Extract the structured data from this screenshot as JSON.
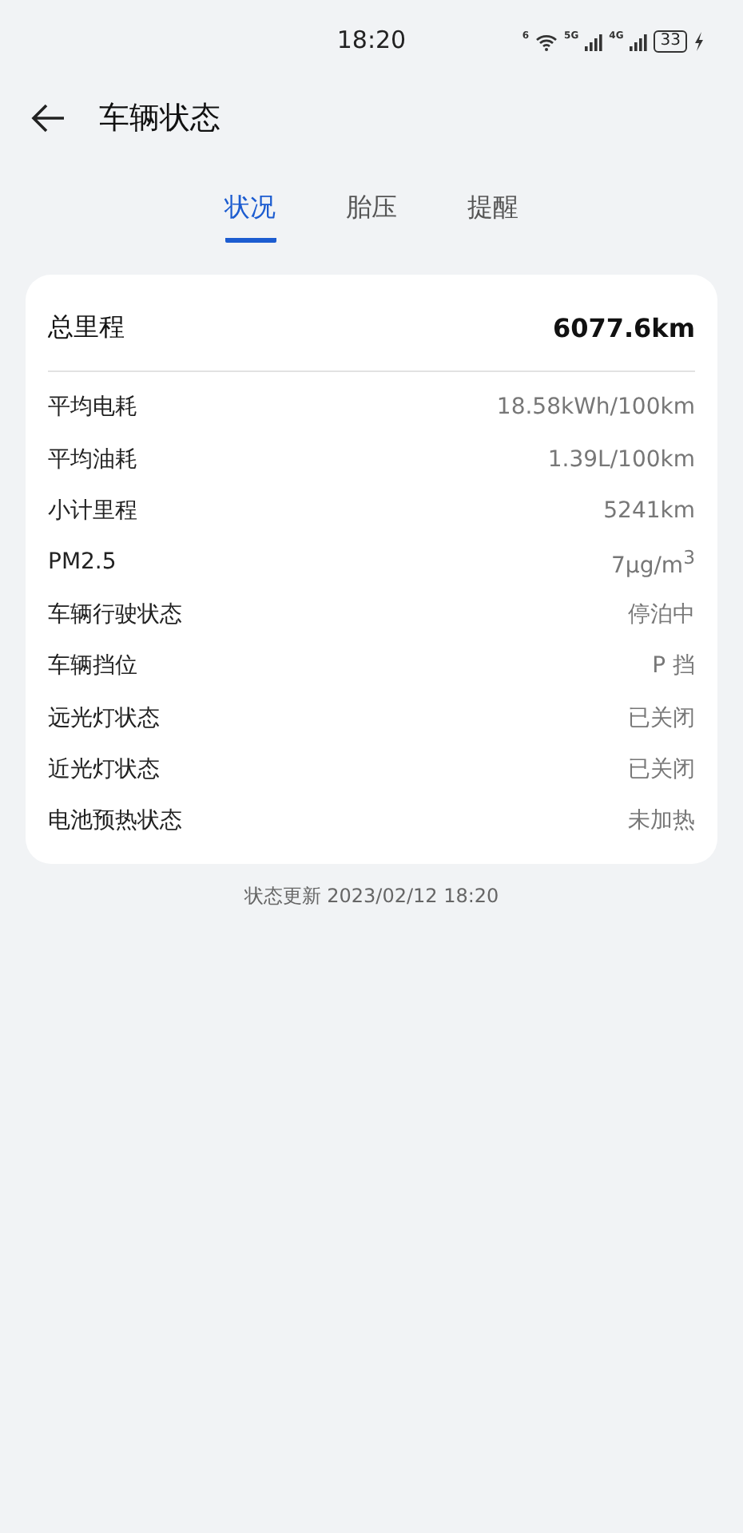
{
  "status_bar": {
    "time": "18:20",
    "wifi_label": "6",
    "networks": [
      "5G",
      "4G"
    ],
    "battery": "33"
  },
  "header": {
    "title": "车辆状态"
  },
  "tabs": [
    {
      "label": "状况",
      "selected": true
    },
    {
      "label": "胎压",
      "selected": false
    },
    {
      "label": "提醒",
      "selected": false
    }
  ],
  "summary": {
    "label": "总里程",
    "value": "6077.6km"
  },
  "rows": [
    {
      "label": "平均电耗",
      "value": "18.58kWh/100km"
    },
    {
      "label": "平均油耗",
      "value": "1.39L/100km"
    },
    {
      "label": "小计里程",
      "value": "5241km"
    },
    {
      "label": "PM2.5",
      "value": "7μg/m$^{3}$"
    },
    {
      "label": "车辆行驶状态",
      "value": "停泊中"
    },
    {
      "label": "车辆挡位",
      "value": "P 挡"
    },
    {
      "label": "远光灯状态",
      "value": "已关闭"
    },
    {
      "label": "近光灯状态",
      "value": "已关闭"
    },
    {
      "label": "电池预热状态",
      "value": "未加热"
    }
  ],
  "footer": "状态更新 2023/02/12 18:20"
}
